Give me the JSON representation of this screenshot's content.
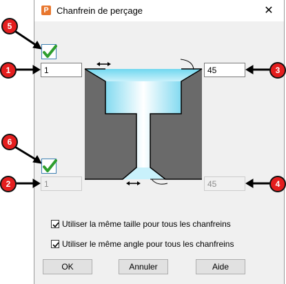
{
  "window": {
    "title": "Chanfrein de perçage",
    "app_icon_letter": "P",
    "close_glyph": "✕"
  },
  "fields": {
    "top_size": "1",
    "top_angle": "45",
    "bottom_size": "1",
    "bottom_angle": "45"
  },
  "checkboxes": {
    "top_chamfer_checked": true,
    "bottom_chamfer_checked": true,
    "same_size_label": "Utiliser la même taille pour tous les chanfreins",
    "same_size_checked": true,
    "same_angle_label": "Utiliser le même angle pour tous les chanfreins",
    "same_angle_checked": true
  },
  "buttons": {
    "ok": "OK",
    "cancel": "Annuler",
    "help": "Aide"
  },
  "callouts": {
    "c1": "1",
    "c2": "2",
    "c3": "3",
    "c4": "4",
    "c5": "5",
    "c6": "6"
  },
  "colors": {
    "callout_fill": "#e41e1e",
    "check_green": "#2e9e2e",
    "hole_cyan": "#6fd7ef",
    "material_gray": "#6a6a6a"
  }
}
